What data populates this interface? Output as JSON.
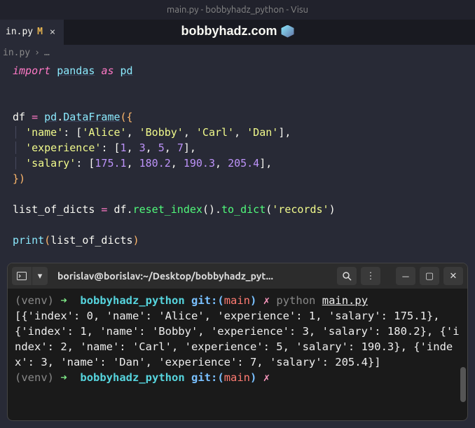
{
  "window": {
    "title": "main.py - bobbyhadz_python - Visu"
  },
  "tab": {
    "label": "in.py",
    "modified_marker": "M",
    "close": "×"
  },
  "overlay": {
    "title": "bobbyhadz.com"
  },
  "breadcrumb": {
    "file": "in.py",
    "sep": "›",
    "more": "…"
  },
  "code": {
    "l1_import": "import",
    "l1_pandas": "pandas",
    "l1_as": "as",
    "l1_pd": "pd",
    "l3_df": "df",
    "l3_eq": " = ",
    "l3_pd": "pd",
    "l3_dot": ".",
    "l3_dataframe": "DataFrame",
    "l3_paren": "({",
    "l4_key": "'name'",
    "l4_colon": ": [",
    "l4_v1": "'Alice'",
    "l4_v2": "'Bobby'",
    "l4_v3": "'Carl'",
    "l4_v4": "'Dan'",
    "l4_close": "],",
    "l5_key": "'experience'",
    "l5_colon": ": [",
    "l5_v1": "1",
    "l5_v2": "3",
    "l5_v3": "5",
    "l5_v4": "7",
    "l5_close": "],",
    "l6_key": "'salary'",
    "l6_colon": ": [",
    "l6_v1": "175.1",
    "l6_v2": "180.2",
    "l6_v3": "190.3",
    "l6_v4": "205.4",
    "l6_close": "],",
    "l7_close": "})",
    "l9_var": "list_of_dicts",
    "l9_eq": " = ",
    "l9_df": "df",
    "l9_dot1": ".",
    "l9_reset": "reset_index",
    "l9_p1": "().",
    "l9_todict": "to_dict",
    "l9_p2": "(",
    "l9_arg": "'records'",
    "l9_p3": ")",
    "l11_print": "print",
    "l11_p1": "(",
    "l11_arg": "list_of_dicts",
    "l11_p2": ")"
  },
  "terminal": {
    "title": "borislav@borislav:~/Desktop/bobbyhadz_pyt...",
    "venv": "(venv)",
    "arrow": "➜",
    "dir": "bobbyhadz_python",
    "git": "git:(",
    "branch": "main",
    "git_close": ")",
    "dirty": "✗",
    "cmd_python": "python",
    "cmd_file": "main.py",
    "output": "[{'index': 0, 'name': 'Alice', 'experience': 1, 'salary': 175.1}, {'index': 1, 'name': 'Bobby', 'experience': 3, 'salary': 180.2}, {'index': 2, 'name': 'Carl', 'experience': 5, 'salary': 190.3}, {'index': 3, 'name': 'Dan', 'experience': 7, 'salary': 205.4}]"
  }
}
